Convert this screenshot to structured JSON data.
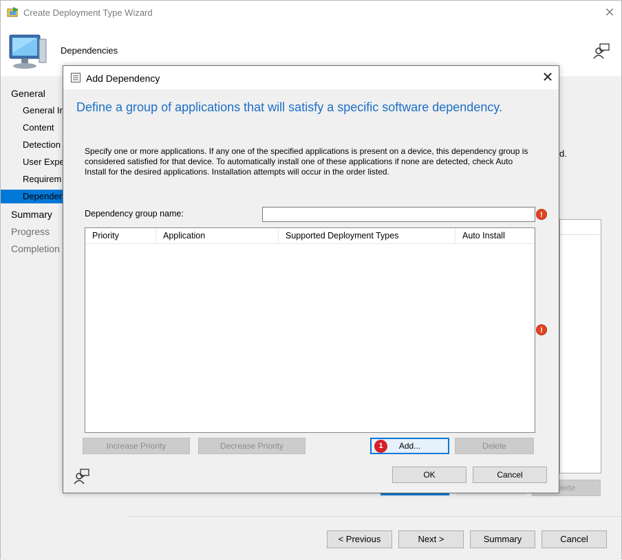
{
  "wizard": {
    "title": "Create Deployment Type Wizard",
    "header_title": "Dependencies",
    "nav": [
      {
        "label": "General",
        "level": "top",
        "state": "normal"
      },
      {
        "label": "General In",
        "level": "sub",
        "state": "normal"
      },
      {
        "label": "Content",
        "level": "sub",
        "state": "normal"
      },
      {
        "label": "Detection",
        "level": "sub",
        "state": "normal"
      },
      {
        "label": "User Expe",
        "level": "sub",
        "state": "normal"
      },
      {
        "label": "Requirem",
        "level": "sub",
        "state": "normal"
      },
      {
        "label": "Depender",
        "level": "sub",
        "state": "selected"
      },
      {
        "label": "Summary",
        "level": "top",
        "state": "normal"
      },
      {
        "label": "Progress",
        "level": "top",
        "state": "dim"
      },
      {
        "label": "Completion",
        "level": "top",
        "state": "dim"
      }
    ],
    "background_text_fragment": "d.",
    "background_delete_label": "elete",
    "buttons": {
      "previous": "< Previous",
      "next": "Next >",
      "summary": "Summary",
      "cancel": "Cancel"
    }
  },
  "dialog": {
    "title": "Add Dependency",
    "heading": "Define a group of applications that will satisfy a specific software dependency.",
    "description": "Specify one or more applications. If any one of the specified applications is present on a device, this dependency group is considered satisfied for that device. To automatically install one of these applications if none are detected, check Auto Install for the desired applications. Installation attempts will occur in the order listed.",
    "group_name_label": "Dependency group name:",
    "group_name_value": "",
    "table": {
      "columns": [
        "Priority",
        "Application",
        "Supported Deployment Types",
        "Auto Install"
      ],
      "rows": []
    },
    "buttons": {
      "increase_priority": "Increase Priority",
      "decrease_priority": "Decrease Priority",
      "add": "Add...",
      "delete": "Delete",
      "ok": "OK",
      "cancel": "Cancel"
    },
    "callout_badge": "1",
    "error_icon_glyph": "!"
  },
  "colors": {
    "accent": "#0078d7",
    "heading_blue": "#1c6fc6",
    "error": "#e0451f",
    "badge": "#d71f26"
  },
  "icons": [
    "wizard-app-icon",
    "computer-monitor-icon",
    "help-person-icon",
    "dialog-form-icon",
    "close-icon",
    "error-icon"
  ]
}
